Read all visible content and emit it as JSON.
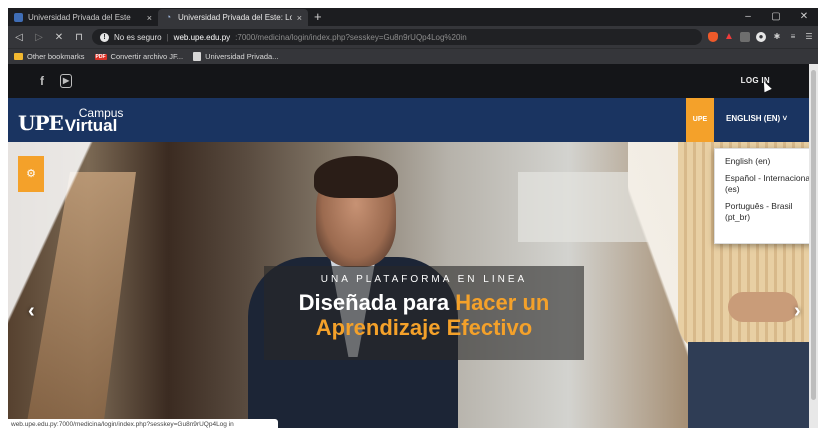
{
  "browser": {
    "tabs": [
      {
        "title": "Universidad Privada del Este",
        "close": "×",
        "active": false
      },
      {
        "title": "Universidad Privada del Este: Log",
        "close": "×",
        "active": true
      }
    ],
    "new_tab": "+",
    "window_controls": {
      "minimize": "–",
      "maximize": "▢",
      "close": "✕"
    },
    "nav": {
      "back": "◁",
      "forward": "▷",
      "stop": "✕",
      "bookmark": "⊓"
    },
    "address": {
      "security_label": "No es seguro",
      "separator": "|",
      "host": "web.upe.edu.py",
      "path": ":7000/medicina/login/index.php?sesskey=Gu8n9rUQp4Log%20in"
    },
    "extension_icons": [
      "brave-shield-icon",
      "alert-triangle-icon",
      "extension-icon",
      "record-icon",
      "puzzle-icon",
      "playlist-icon",
      "menu-icon"
    ],
    "bookmarks": [
      {
        "label": "Other bookmarks",
        "icon": "folder-icon"
      },
      {
        "label": "Convertir archivo JF...",
        "icon": "pdf-icon"
      },
      {
        "label": "Universidad Privada...",
        "icon": "document-icon"
      }
    ],
    "status_url": "web.upe.edu.py:7000/medicina/login/index.php?sesskey=Gu8n9rUQp4Log in"
  },
  "site": {
    "social": {
      "facebook": "f",
      "youtube": "You Tube"
    },
    "login_label": "LOG IN",
    "logo": {
      "upe": "UPE",
      "campus": "Campus",
      "virtual": "Virtual"
    },
    "upe_badge": "UPE",
    "language_button": "ENGLISH (EN) ˅",
    "language_options": [
      "English (en)",
      "Español - Internacional (es)",
      "Português - Brasil (pt_br)"
    ],
    "hero": {
      "kicker": "UNA PLATAFORMA EN LINEA",
      "headline_white": "Diseñada para",
      "headline_orange_1": "Hacer un",
      "headline_orange_2": "Aprendizaje Efectivo",
      "gear_icon": "⚙",
      "prev_arrow": "‹",
      "next_arrow": "›"
    }
  },
  "colors": {
    "navbar": "#1a3461",
    "accent": "#f4a12a",
    "browser_chrome": "#35363a"
  }
}
